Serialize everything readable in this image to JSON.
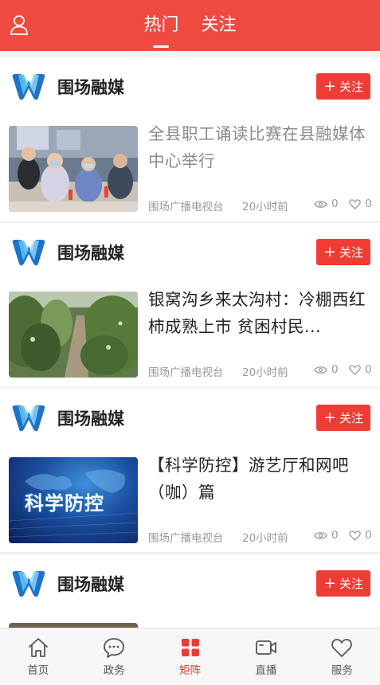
{
  "header": {
    "tabs": [
      {
        "label": "热门",
        "active": true
      },
      {
        "label": "关注",
        "active": false
      }
    ]
  },
  "colors": {
    "brand": "#f04b41",
    "follow_button": "#ef3c34",
    "active_nav": "#ef3c34"
  },
  "feed": [
    {
      "source_name": "围场融媒",
      "follow_label": "关注",
      "title": "全县职工诵读比赛在县融媒体中心举行",
      "read": true,
      "meta_source": "围场广播电视台",
      "time": "20小时前",
      "views": "0",
      "likes": "0"
    },
    {
      "source_name": "围场融媒",
      "follow_label": "关注",
      "title": "银窝沟乡来太沟村：冷棚西红柿成熟上市 贫困村民...",
      "read": false,
      "meta_source": "围场广播电视台",
      "time": "20小时前",
      "views": "0",
      "likes": "0"
    },
    {
      "source_name": "围场融媒",
      "follow_label": "关注",
      "title": "【科学防控】游艺厅和网吧（咖）篇",
      "thumb_text": "科学防控",
      "read": false,
      "meta_source": "围场广播电视台",
      "time": "20小时前",
      "views": "0",
      "likes": "0"
    },
    {
      "source_name": "围场融媒",
      "follow_label": "关注"
    }
  ],
  "bottom_nav": [
    {
      "label": "首页",
      "icon": "home-icon"
    },
    {
      "label": "政务",
      "icon": "chat-bubble-icon"
    },
    {
      "label": "矩阵",
      "icon": "grid-icon",
      "active": true
    },
    {
      "label": "直播",
      "icon": "video-camera-icon"
    },
    {
      "label": "服务",
      "icon": "heart-icon"
    }
  ]
}
